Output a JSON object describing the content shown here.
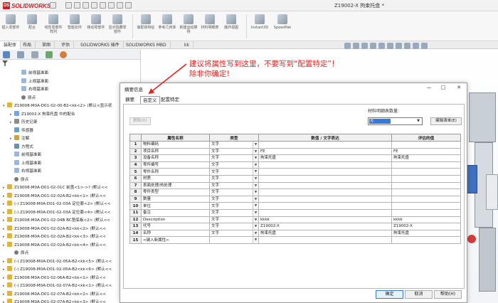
{
  "app": {
    "logo_text": "SOLIDWORKS",
    "logo_mark": "DS",
    "document_title": "Z19002-X 拘束托盘 *"
  },
  "ribbon": {
    "tools": [
      {
        "label": "插入零部件",
        "icon": "insert-component-icon"
      },
      {
        "label": "配合",
        "icon": "mate-icon"
      },
      {
        "label": "线性零部件阵列",
        "icon": "pattern-icon"
      },
      {
        "label": "智能扣件",
        "icon": "fastener-icon"
      },
      {
        "label": "移动零部件",
        "icon": "move-component-icon"
      },
      {
        "label": "显示隐藏零部件",
        "icon": "show-hide-icon"
      },
      {
        "label": "装配体特征",
        "icon": "assembly-feature-icon"
      },
      {
        "label": "参考几何体",
        "icon": "reference-geometry-icon"
      },
      {
        "label": "新建运动算例",
        "icon": "motion-study-icon"
      },
      {
        "label": "材料明细表",
        "icon": "bom-icon"
      },
      {
        "label": "爆炸视图",
        "icon": "explode-view-icon"
      },
      {
        "label": "Instant3D",
        "icon": "instant3d-icon"
      },
      {
        "label": "SpeedPak",
        "icon": "speedpak-icon"
      }
    ]
  },
  "tabs": [
    "装配体",
    "布局",
    "草图",
    "评估",
    "SOLIDWORKS 插件",
    "SOLIDWORKS MBD",
    "kk"
  ],
  "tree": {
    "items": [
      {
        "text": "前视基准面",
        "icon": "plane-icon",
        "indent": 2,
        "caret": ""
      },
      {
        "text": "上视基准面",
        "icon": "plane-icon",
        "indent": 2,
        "caret": ""
      },
      {
        "text": "右视基准面",
        "icon": "plane-icon",
        "indent": 2,
        "caret": ""
      },
      {
        "text": "原点",
        "icon": "origin-icon",
        "indent": 2,
        "caret": ""
      },
      {
        "text": "Z19008-M0A-D01-02-00-B2<kk<2> (默认<显示状",
        "icon": "part-icon",
        "indent": 0,
        "caret": "▾"
      },
      {
        "text": "Z19002-X 拘束托盘 中的配合",
        "icon": "mate-folder-icon",
        "indent": 1,
        "caret": "▸"
      },
      {
        "text": "历史记录",
        "icon": "history-icon",
        "indent": 1,
        "caret": "▸"
      },
      {
        "text": "传感器",
        "icon": "sensor-icon",
        "indent": 1,
        "caret": ""
      },
      {
        "text": "注解",
        "icon": "annotation-icon",
        "indent": 1,
        "caret": "▸"
      },
      {
        "text": "方程式",
        "icon": "equation-icon",
        "indent": 1,
        "caret": ""
      },
      {
        "text": "前视基准面",
        "icon": "plane-icon",
        "indent": 1,
        "caret": ""
      },
      {
        "text": "上视基准面",
        "icon": "plane-icon",
        "indent": 1,
        "caret": ""
      },
      {
        "text": "右视基准面",
        "icon": "plane-icon",
        "indent": 1,
        "caret": ""
      },
      {
        "text": "原点",
        "icon": "origin-icon",
        "indent": 1,
        "caret": ""
      },
      {
        "text": "Z19008-M0A-D01-02-01C 前盖<1>->? (默认<<",
        "icon": "part-icon",
        "indent": 0,
        "caret": "▸"
      },
      {
        "text": "Z19008-M0A-D01-02-02A-B2<kk<1> (默认<<",
        "icon": "part-icon",
        "indent": 0,
        "caret": "▸"
      },
      {
        "text": "(-) Z19008-M0A-D01-02-03A 定位套<2> (默认<<",
        "icon": "part-icon",
        "indent": 0,
        "caret": "▸"
      },
      {
        "text": "(-) Z19008-M0A-D01-02-03A 定位套<4> (默认<<",
        "icon": "part-icon",
        "indent": 0,
        "caret": "▸"
      },
      {
        "text": "Z19008-M0A-D01-02-04B BC垫底板<2> (默认<<",
        "icon": "part-icon",
        "indent": 0,
        "caret": "▸"
      },
      {
        "text": "Z19008-M0A-D01-02-02A-B2<kk<2> (默认<<",
        "icon": "part-icon",
        "indent": 0,
        "caret": "▸"
      },
      {
        "text": "Z19008-M0A-D01-02-02A-B2<kk<3> (默认<<",
        "icon": "part-icon",
        "indent": 0,
        "caret": "▸"
      },
      {
        "text": "Z19008-M0A-D01-02-02A-B2<kk<4> (默认<<",
        "icon": "part-icon",
        "indent": 0,
        "caret": "▸"
      },
      {
        "text": "原点",
        "icon": "origin-icon",
        "indent": 1,
        "caret": ""
      },
      {
        "text": "(-) Z19008-M0A-D01-02-05A-B2<kk<5> (默认<<",
        "icon": "part-icon",
        "indent": 0,
        "caret": "▸"
      },
      {
        "text": "(-) Z19008-M0A-D01-02-05A-B2<kk<6> (默认<<",
        "icon": "part-icon",
        "indent": 0,
        "caret": "▸"
      },
      {
        "text": "Z19008-M0A-D01-02-06A-B2<kk<1> (默认<<",
        "icon": "part-icon",
        "indent": 0,
        "caret": "▸"
      },
      {
        "text": "(-) Z19008-M0A-D01-02-07A-B2<kk<1> (默认<<",
        "icon": "part-icon",
        "indent": 0,
        "caret": "▸"
      },
      {
        "text": "Z19008-M0A-D01-02-07A-B2<kk<2> (默认<<",
        "icon": "part-icon",
        "indent": 0,
        "caret": "▸"
      },
      {
        "text": "Z19008-M0A-D01-02-07A-B2<kk<3> (默认<<",
        "icon": "part-icon",
        "indent": 0,
        "caret": "▸"
      },
      {
        "text": "Z19008-M0A-D01-02-07A-B2<kk<4> (默认<<",
        "icon": "part-icon",
        "indent": 0,
        "caret": "▸"
      }
    ]
  },
  "annotation": {
    "line1": "建议将属性写到这里，不要写到“配置特定”！",
    "line2": "除非你确定!",
    "color": "#e8211e"
  },
  "dialog": {
    "title": "摘要信息",
    "window_buttons": [
      "—",
      "□",
      "✕"
    ],
    "tabs": [
      "摘要",
      "自定义",
      "配置特定"
    ],
    "active_tab": "自定义",
    "delete_label": "删除(D)",
    "bom_qty_label": "材料明细表数量:",
    "bom_qty_value": "无",
    "edit_list_label": "编辑清单(E)",
    "columns": [
      "",
      "属性名称",
      "类型",
      "数值 / 文字表达",
      "评估的值"
    ],
    "rows": [
      {
        "num": "1",
        "name": "物料编码",
        "type": "文字",
        "value": "",
        "evaluated": ""
      },
      {
        "num": "2",
        "name": "项目名称",
        "type": "文字",
        "value": "FE",
        "evaluated": "FE"
      },
      {
        "num": "3",
        "name": "设备名称",
        "type": "文字",
        "value": "拘束托盘",
        "evaluated": "拘束托盘"
      },
      {
        "num": "4",
        "name": "零件编号",
        "type": "文字",
        "value": "",
        "evaluated": ""
      },
      {
        "num": "5",
        "name": "零件名称",
        "type": "文字",
        "value": "",
        "evaluated": ""
      },
      {
        "num": "6",
        "name": "材质",
        "type": "文字",
        "value": "",
        "evaluated": ""
      },
      {
        "num": "7",
        "name": "表面处理/热处理",
        "type": "文字",
        "value": "",
        "evaluated": ""
      },
      {
        "num": "8",
        "name": "零件类型",
        "type": "文字",
        "value": "",
        "evaluated": ""
      },
      {
        "num": "9",
        "name": "数量",
        "type": "文字",
        "value": "",
        "evaluated": ""
      },
      {
        "num": "10",
        "name": "单位",
        "type": "文字",
        "value": "",
        "evaluated": ""
      },
      {
        "num": "11",
        "name": "备注",
        "type": "文字",
        "value": "",
        "evaluated": ""
      },
      {
        "num": "12",
        "name": "Description",
        "type": "文字",
        "value": "kkkk",
        "evaluated": "kkkk"
      },
      {
        "num": "13",
        "name": "代号",
        "type": "文字",
        "value": "Z19002-X",
        "evaluated": "Z19002-X"
      },
      {
        "num": "14",
        "name": "名称",
        "type": "文字",
        "value": "拘束托盘",
        "evaluated": "拘束托盘"
      },
      {
        "num": "15",
        "name": "<键入新属性>",
        "type": "",
        "value": "",
        "evaluated": ""
      }
    ],
    "buttons": {
      "ok": "确定",
      "cancel": "取消",
      "help": "帮助(H)"
    }
  }
}
